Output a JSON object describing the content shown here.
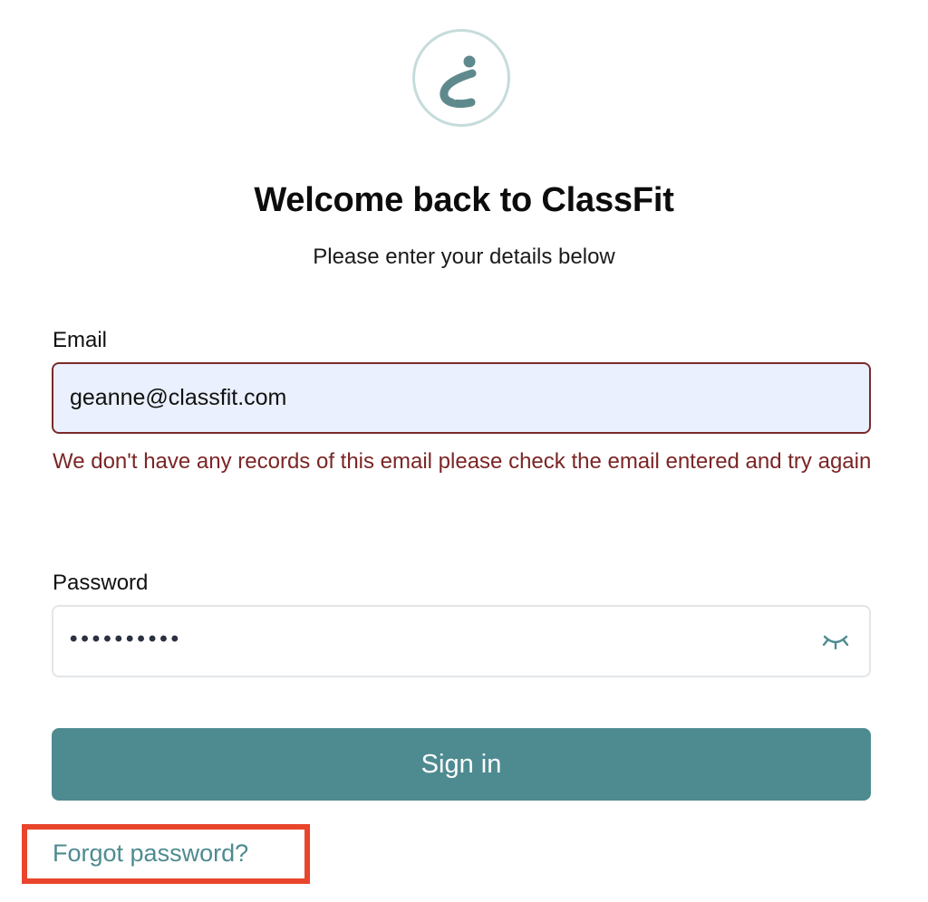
{
  "logo": {
    "icon": "classfit-logo-icon",
    "ring_color": "#c5dcdb",
    "mark_color": "#5f8a8d"
  },
  "header": {
    "title": "Welcome back to ClassFit",
    "subtitle": "Please enter your details below"
  },
  "form": {
    "email": {
      "label": "Email",
      "value": "geanne@classfit.com",
      "error": "We don't have any records of this email please check the email entered and try again"
    },
    "password": {
      "label": "Password",
      "masked_value": "••••••••••",
      "toggle_icon": "eye-closed-icon"
    },
    "submit_label": "Sign in",
    "forgot_label": "Forgot password?"
  },
  "colors": {
    "accent": "#4e8b91",
    "error": "#7b2525",
    "highlight": "#e8452c",
    "email_fill": "#eaf0fd"
  }
}
